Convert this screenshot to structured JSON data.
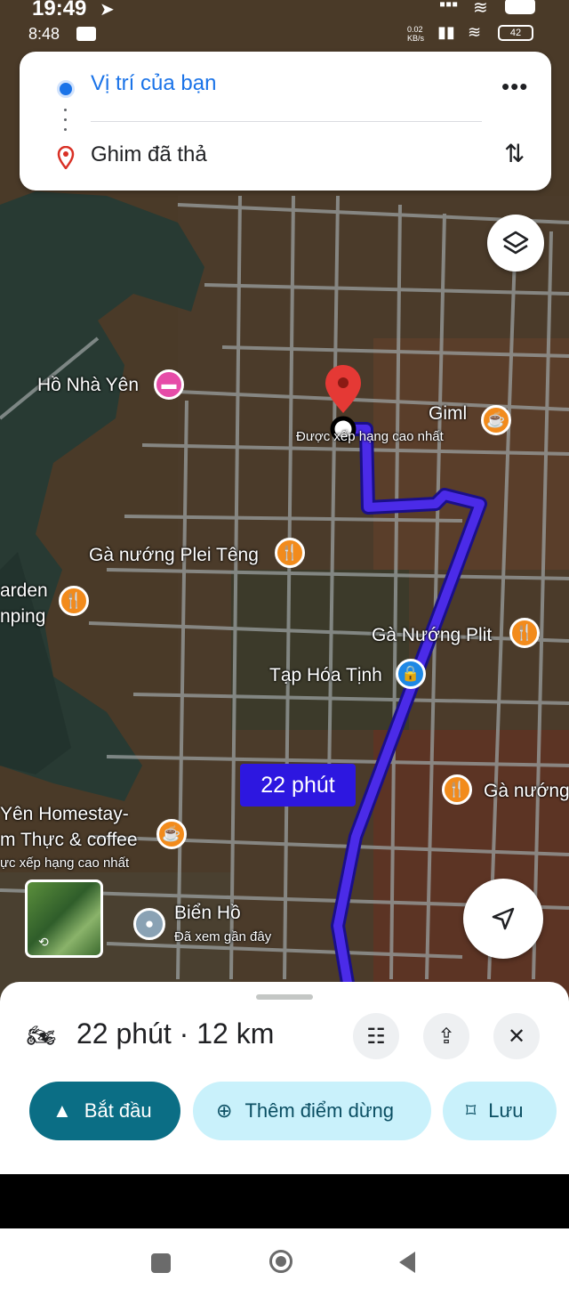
{
  "status_outer": {
    "time": "19:49"
  },
  "status_inner": {
    "time": "8:48",
    "net_speed": "0.02\nKB/s",
    "battery": "42"
  },
  "directions": {
    "origin": "Vị trí của bạn",
    "destination": "Ghim đã thả"
  },
  "map": {
    "labels": {
      "ho_nha_yen": "Hồ Nhà Yên",
      "giml": "Giml",
      "duoc_xep_hang": "Được xếp hạng cao nhất",
      "ga_nuong_plei_teng": "Gà nướng Plei Têng",
      "arden": "arden",
      "nping": "nping",
      "ga_nuong_plit": "Gà Nướng Plit",
      "tap_hoa_tinh": "Tạp Hóa Tịnh",
      "ga_nuong_right": "Gà nướng",
      "yen_homestay": "Yên Homestay-",
      "m_thuc_coffee": "m Thực & coffee",
      "uc_xep_hang": "ực xếp hạng cao nhất",
      "bien_ho": "Biển Hồ",
      "da_xem": "Đã xem gần đây"
    },
    "route_time": "22 phút"
  },
  "sheet": {
    "summary": "22 phút · 12 km",
    "start_label": "Bắt đầu",
    "add_stop_label": "Thêm điểm dừng",
    "save_label": "Lưu"
  },
  "colors": {
    "route": "#4b2be8",
    "start_button": "#0b6e85",
    "secondary_button": "#c9f1fb",
    "pin": "#e53935"
  }
}
